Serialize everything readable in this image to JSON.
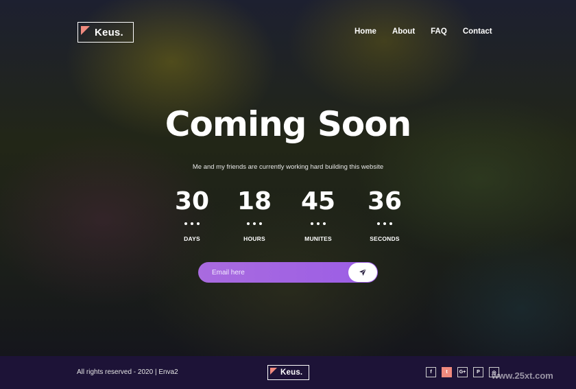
{
  "brand": {
    "name": "Keus.",
    "accent": "#f08a7e"
  },
  "nav": {
    "items": [
      "Home",
      "About",
      "FAQ",
      "Contact"
    ]
  },
  "hero": {
    "title": "Coming Soon",
    "subtitle": "Me and my friends are currently working hard  building this website"
  },
  "countdown": {
    "days": {
      "value": "30",
      "label": "DAYS"
    },
    "hours": {
      "value": "18",
      "label": "HOURS"
    },
    "minutes": {
      "value": "45",
      "label": "MUNITES"
    },
    "seconds": {
      "value": "36",
      "label": "SECONDS"
    }
  },
  "subscribe": {
    "placeholder": "Email here",
    "icon": "paper-plane-icon",
    "color": "#a96bdf"
  },
  "footer": {
    "copyright": "All rights reserved - 2020 | Enva2",
    "brand": "Keus.",
    "background": "#1d1337",
    "socials": [
      {
        "icon": "facebook-icon",
        "glyph": "f"
      },
      {
        "icon": "twitter-icon",
        "glyph": "t"
      },
      {
        "icon": "google-plus-icon",
        "glyph": "G+"
      },
      {
        "icon": "pinterest-icon",
        "glyph": "P"
      },
      {
        "icon": "dribbble-icon",
        "glyph": "◎"
      }
    ]
  },
  "watermark": "www.25xt.com"
}
